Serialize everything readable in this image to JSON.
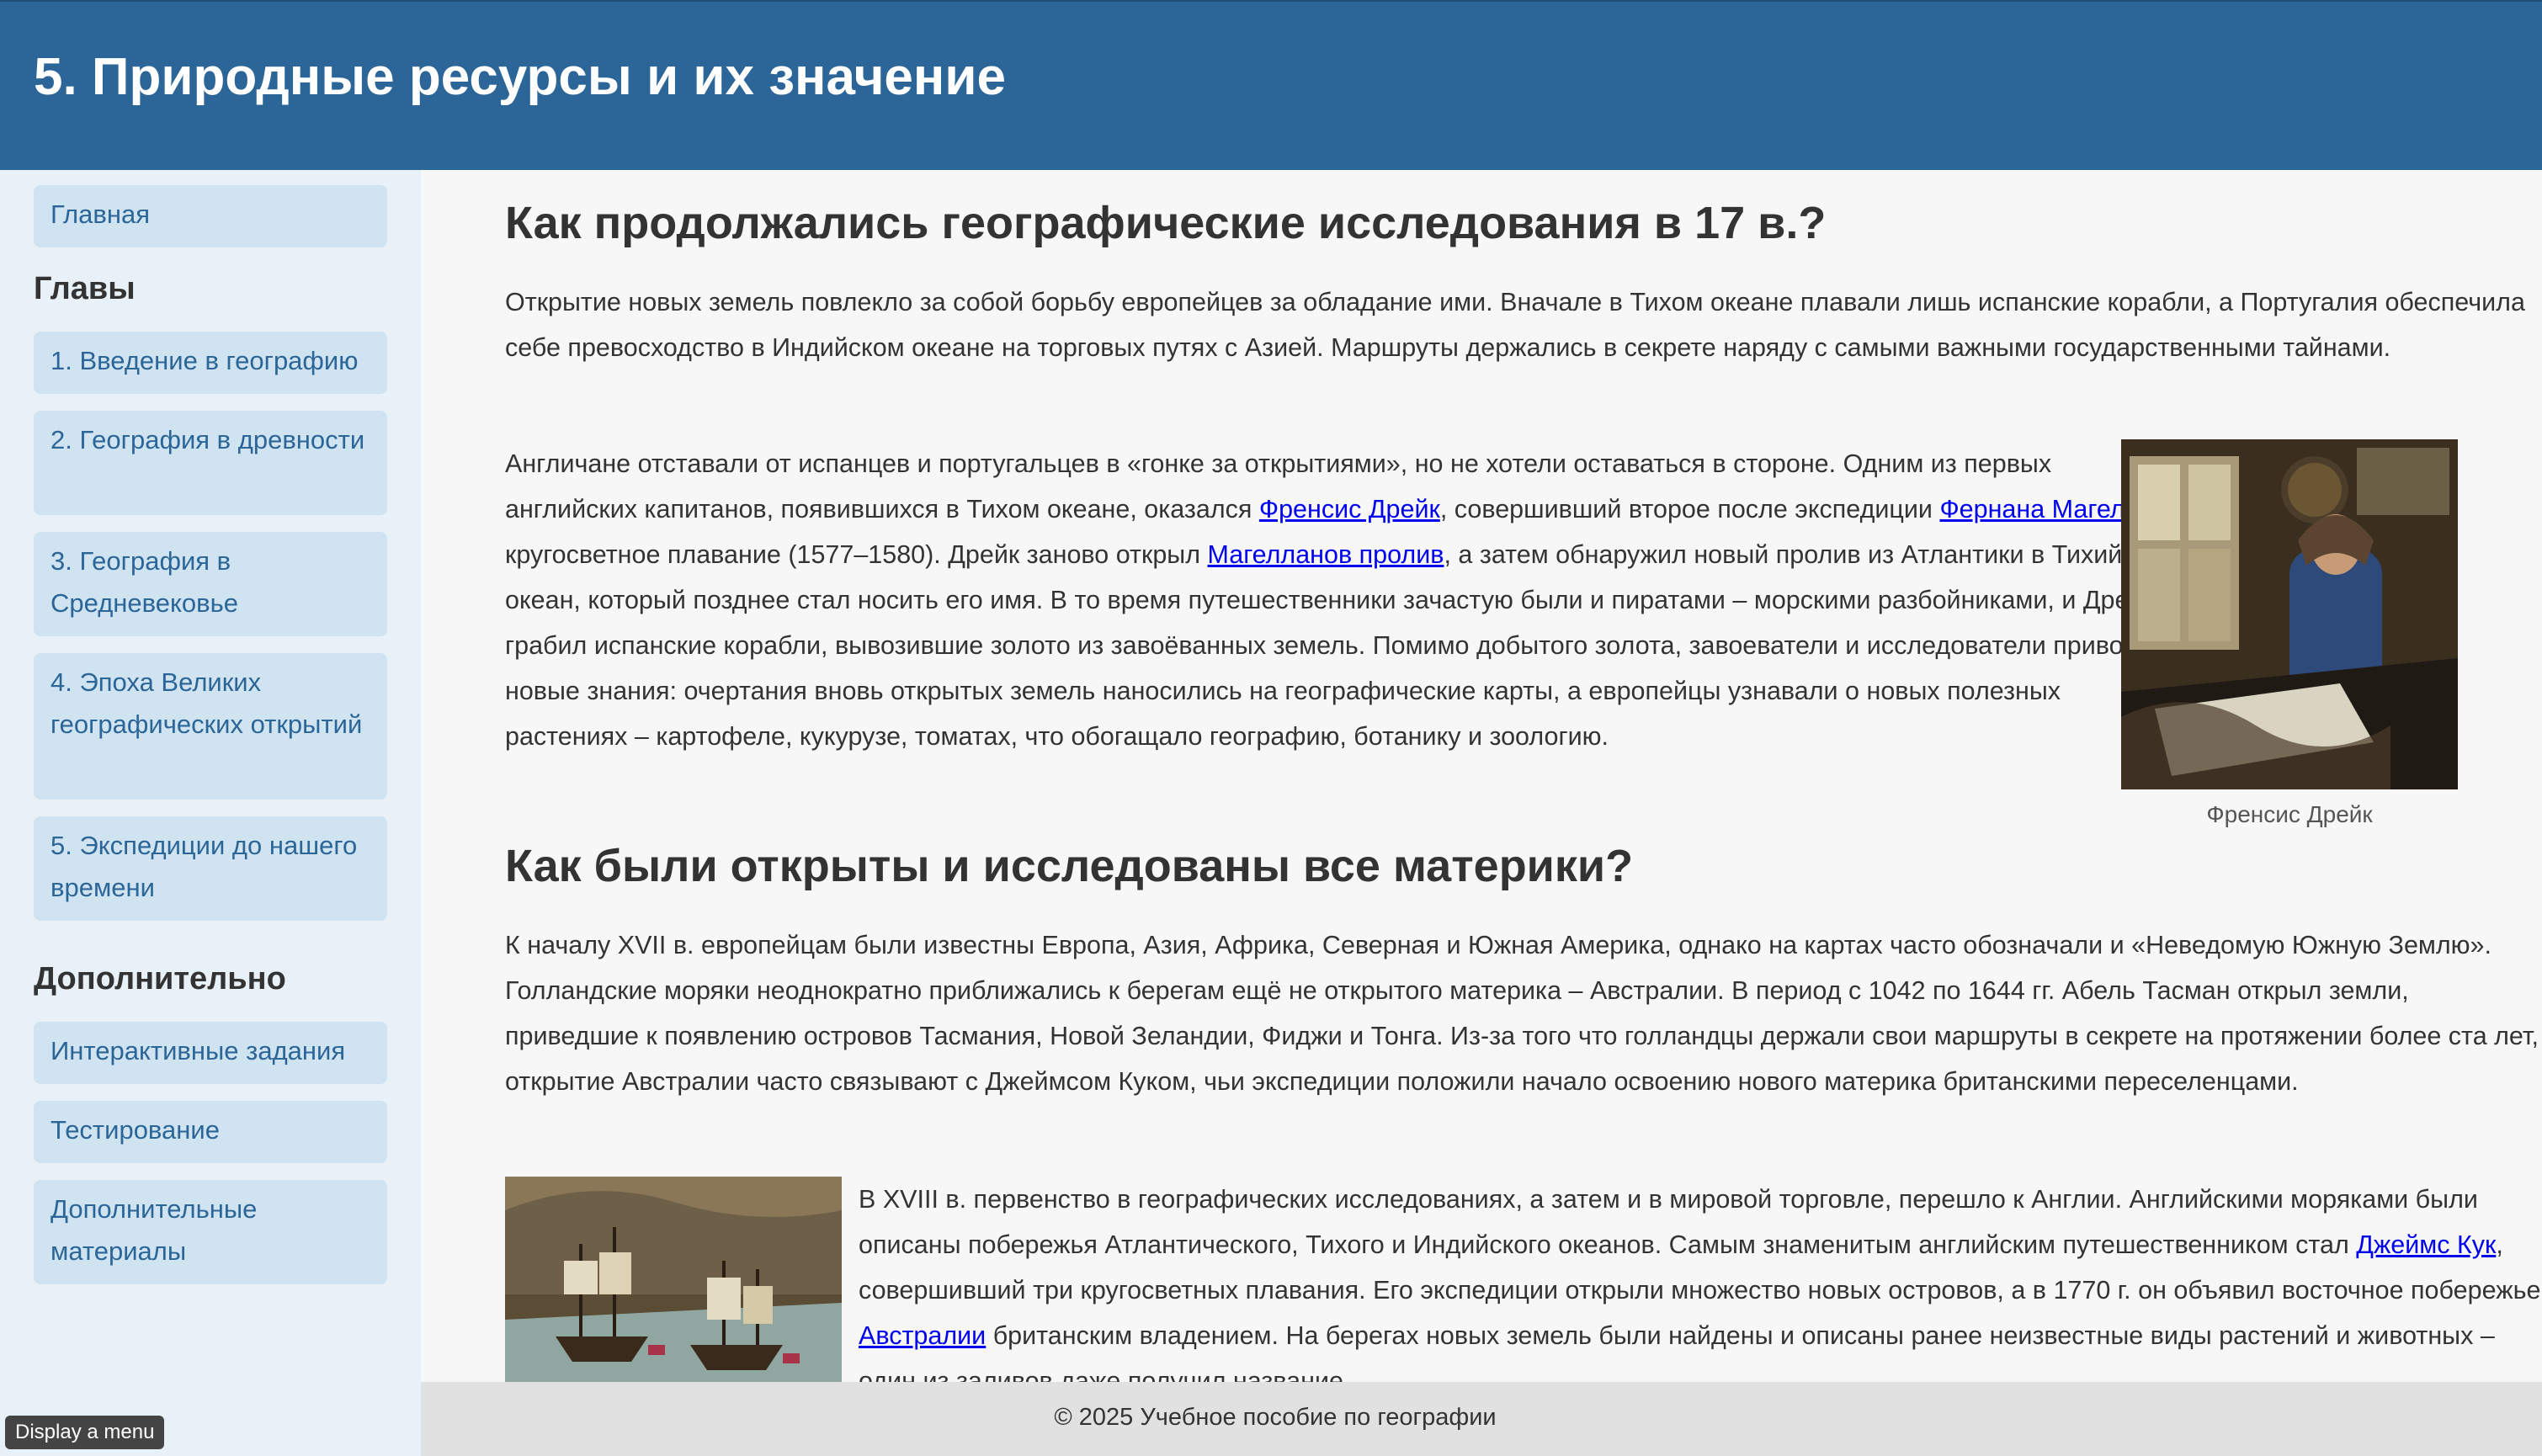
{
  "header": {
    "title": "5. Природные ресурсы и их значение"
  },
  "sidebar": {
    "home": "Главная",
    "chapters_heading": "Главы",
    "chapters": [
      "1. Введение в географию",
      "2. География в древности",
      "3. География в Средневековье",
      "4. Эпоха Великих географических открытий",
      "5. Экспедиции до нашего времени"
    ],
    "extra_heading": "Дополнительно",
    "extra": [
      "Интерактивные задания",
      "Тестирование",
      "Дополнительные материалы"
    ]
  },
  "main": {
    "section1_title": "Как продолжались географические исследования в 17 в.?",
    "p1": "Открытие новых земель повлекло за собой борьбу европейцев за обладание ими. Вначале в Тихом океане плавали лишь испанские корабли, а Португалия обеспечила себе превосходство в Индийском океане на торговых путях с Азией. Маршруты держались в секрете наряду с самыми важными государственными тайнами.",
    "p2": {
      "t1": "Англичане отставали от испанцев и португальцев в «гонке за открытиями», но не хотели оставаться в стороне. Одним из первых английских капитанов, появившихся в Тихом океане, оказался ",
      "l1": "Френсис Дрейк",
      "t2": ", совершивший второе после экспедиции ",
      "l2": "Фернана Магеллана",
      "t3": " кругосветное плавание (1577–1580). Дрейк заново открыл ",
      "l3": "Магелланов пролив",
      "t4": ", а затем обнаружил новый пролив из Атлантики в Тихий океан, который позднее стал носить его имя. В то время путешественники зачастую были и пиратами – морскими разбойниками, и Дрейк грабил испанские корабли, вывозившие золото из завоёванных земель. Помимо добытого золота, завоеватели и исследователи привозили новые знания: очертания вновь открытых земель наносились на географические карты, а европейцы узнавали о новых полезных растениях – картофеле, кукурузе, томатах, что обогащало географию, ботанику и зоологию."
    },
    "figure1_caption": "Френсис Дрейк",
    "section2_title": "Как были открыты и исследованы все материки?",
    "p3": "К началу XVII в. европейцам были известны Европа, Азия, Африка, Северная и Южная Америка, однако на картах часто обозначали и «Неведомую Южную Землю». Голландские моряки неоднократно приближались к берегам ещё не открытого материка – Австралии. В период с 1042 по 1644 гг. Абель Тасман открыл земли, приведшие к появлению островов Тасмания, Новой Зеландии, Фиджи и Тонга. Из-за того что голландцы держали свои маршруты в секрете на протяжении более ста лет, открытие Австралии часто связывают с Джеймсом Куком, чьи экспедиции положили начало освоению нового материка британскими переселенцами.",
    "p4": {
      "t1": "В XVIII в. первенство в географических исследованиях, а затем и в мировой торговле, перешло к Англии. Английскими моряками были описаны побережья Атлантического, Тихого и Индийского океанов. Самым знаменитым английским путешественником стал ",
      "l1": "Джеймс Кук",
      "t2": ", совершивший три кругосветных плавания. Его экспедиции открыли множество новых островов, а в 1770 г. он объявил восточное побережье ",
      "l2": "Австралии",
      "t3": " британским владением. На берегах новых земель были найдены и описаны ранее неизвестные виды растений и животных – один из заливов даже получил название"
    }
  },
  "footer": {
    "text": "© 2025 Учебное пособие по географии"
  },
  "menu_button": "Display a menu"
}
